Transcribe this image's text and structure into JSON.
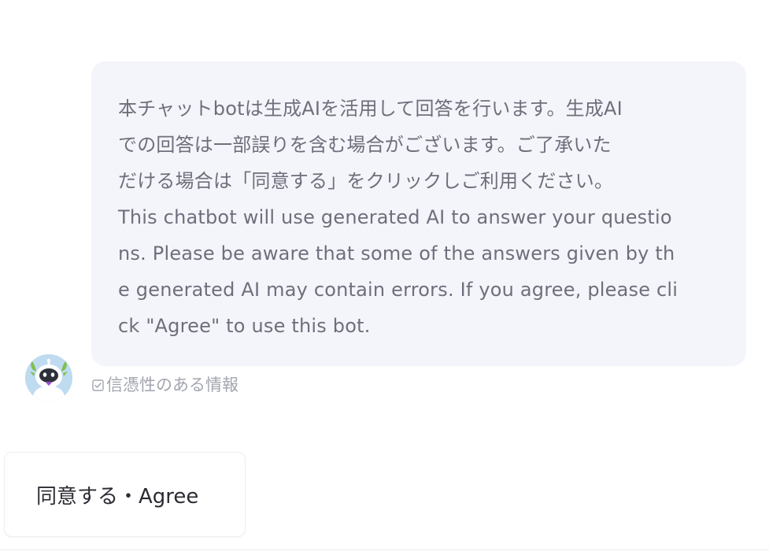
{
  "message": {
    "lines": [
      "本チャットbotは生成AIを活用して回答を行います。生成AI",
      "での回答は一部誤りを含む場合がございます。ご了承いた",
      "だける場合は「同意する」をクリックしご利用ください。",
      "This chatbot will use generated AI to answer your questio",
      "ns. Please be aware that some of the answers given by th",
      "e generated AI may contain errors. If you agree, please cli",
      "ck \"Agree\" to use this bot."
    ]
  },
  "avatar": {
    "icon": "robot-icon"
  },
  "reliability": {
    "icon": "checkbox-icon",
    "label": "信憑性のある情報"
  },
  "agree_button": {
    "label": "同意する・Agree"
  },
  "colors": {
    "bubble_bg": "#f4f5fa",
    "message_text": "#6e6f7c",
    "avatar_bg": "#bfdbf0",
    "avatar_accent": "#7fbf4d",
    "muted_text": "#a3a5b0"
  }
}
